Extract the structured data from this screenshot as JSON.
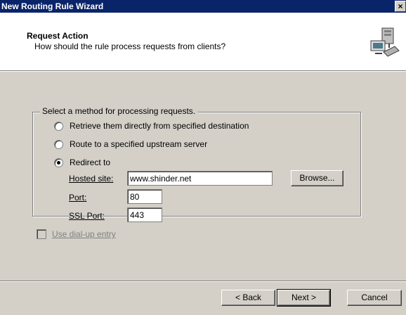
{
  "window": {
    "title": "New Routing Rule Wizard",
    "close_glyph": "×"
  },
  "header": {
    "title": "Request Action",
    "subtitle": "How should the rule process requests from clients?"
  },
  "group": {
    "legend": "Select a method for processing requests.",
    "options": [
      {
        "label": "Retrieve them directly from specified destination",
        "selected": false
      },
      {
        "label": "Route to a specified upstream server",
        "selected": false
      },
      {
        "label": "Redirect to",
        "selected": true
      }
    ],
    "hosted_site_label": "Hosted site:",
    "hosted_site_value": "www.shinder.net",
    "browse_label": "Browse...",
    "port_label": "Port:",
    "port_value": "80",
    "ssl_port_label": "SSL Port:",
    "ssl_port_value": "443"
  },
  "dialup": {
    "label": "Use dial-up entry",
    "checked": false,
    "enabled": false
  },
  "buttons": {
    "back": "< Back",
    "next": "Next >",
    "cancel": "Cancel"
  }
}
